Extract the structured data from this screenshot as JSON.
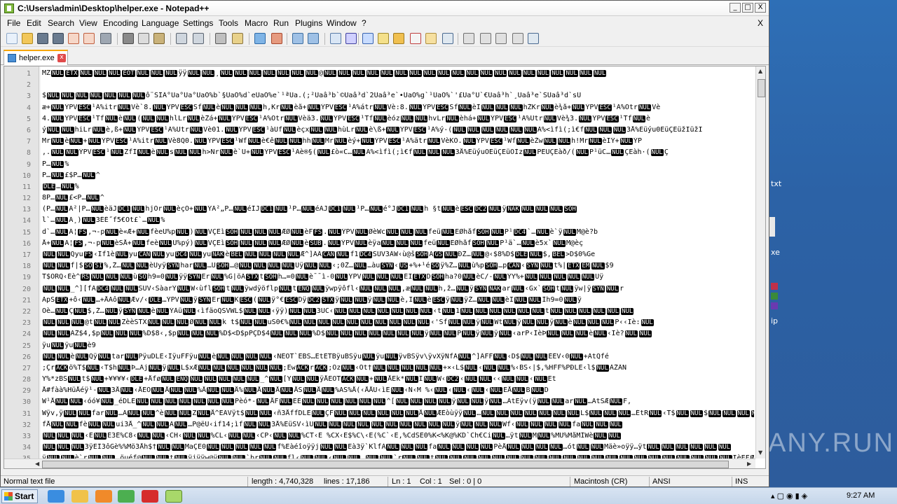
{
  "window": {
    "title": "C:\\Users\\admin\\Desktop\\helper.exe - Notepad++",
    "min": "_",
    "max": "□",
    "close": "X"
  },
  "menu": {
    "items": [
      "File",
      "Edit",
      "Search",
      "View",
      "Encoding",
      "Language",
      "Settings",
      "Tools",
      "Macro",
      "Run",
      "Plugins",
      "Window",
      "?"
    ],
    "close_doc": "X"
  },
  "toolbar": {
    "icons": [
      "new-file-icon",
      "open-file-icon",
      "save-icon",
      "save-all-icon",
      "close-icon",
      "close-all-icon",
      "print-icon",
      "cut-icon",
      "copy-icon",
      "paste-icon",
      "undo-icon",
      "redo-icon",
      "find-icon",
      "replace-icon",
      "zoom-in-icon",
      "zoom-out-icon",
      "sync-v-icon",
      "sync-h-icon",
      "word-wrap-icon",
      "all-chars-icon",
      "indent-guide-icon",
      "user-lang-icon",
      "doc-map-icon",
      "function-list-icon",
      "folder-workspace-icon",
      "monitor-icon",
      "record-macro-icon",
      "stop-record-icon",
      "play-macro-icon",
      "play-multiple-icon",
      "save-macro-icon"
    ]
  },
  "tab": {
    "label": "helper.exe",
    "close": "x"
  },
  "editor": {
    "lines": [
      {
        "n": "1",
        "text": "MZ\u0000\u0003\u0000\u0000\u0000\u0004\u0000\u0000\u0000ÿÿ\u0000\u0000¸\u0000\u0000\u0000\u0000\u0000\u0000\u0000@\u0000\u0000\u0000\u0000\u0000\u0000\u0000\u0000\u0000\u0000\u0000\u0000\u0000\u0000\u0000\u0000\u0000\u0000\u0000\u0000"
      },
      {
        "n": "2",
        "text": ""
      },
      {
        "n": "3",
        "text": "$\u0000\u0000\u0000\u0000\u0000\u0000\u0000ô¨SIÃ°Ûa°Ûa°ÛaÕ%b`§ŨaÕ%d`eŨaÕ%e`¹ªŨa.(;²Ûaâ³b`©Ûaâ³d`2Ûaâ³e`•ŨaÕ%g`¹ŨaÕ%`'£Ûa°Û`€Ûaâ³h`¸Ûaâ³e`ŠŨaâ³d`sŨ"
      },
      {
        "n": "4",
        "text": "æ+\u0000ÝPV\u001b¹Ã%itr\u0000Vè`8.\u0000ÝPV\u001bŠf\u0000è\u0000\u0000\u0000h,Kr\u0000èå+\u0000ÝPV\u001b¹Ã%átr\u0000Vè:8.\u0000ÝPV\u001bŠf\u0000èÌ\u0000\u0000\u0000hŽKr\u0000è¾å+\u0000ÝPV\u001b¹Ã%Ötr\u0000Vè"
      },
      {
        "n": "5",
        "text": "4.\u0000ÝPV\u001b¹Tf\u0000è\u0000(\u0000\u0000hlLr\u0000èŽá+\u0000ÝPV\u001b¹Ã%Ötr\u0000Vèä3.\u0000ÝPV\u001b¹Tf\u0000èóz\u0000\u0000hvLr\u0000èhá+\u0000ÝPV\u001b¹Ã%Ütr\u0000Vè¾3.\u0000ÝPV\u001b¹Tf\u0000è"
      },
      {
        "n": "6",
        "text": "ý\u0000\u0000hiLr\u0000è,ß+\u0000ÝPV\u001b¹Ã%Ütr\u0000Vè01.\u0000ÝPV\u001b¹àUf\u0000èçx\u0000\u0000hùLr\u0000è\\ß+\u0000ÝPV\u001b¹Ã%ý-(\u0000\u0000\u0000\u0000\u0000\u0000Ã%<ìfì(;ì€f\u0000\u0000\u00003Å%Eüýu0EüÇEüžIüžI"
      },
      {
        "n": "7",
        "text": "Mr\u0000è\u0000+\u0000ÝPV\u001b¹Ã%itr\u0000Vè8Q0.\u0000ÝPV\u001b¹Wf\u0000è€ê\u0000\u0000hh\u0000Mr\u0000èý+\u0000ÝPV\u001b¹Ã%ätr\u0000VèKO.\u0000ÝPV\u001b¹Wf\u0000èŽw\u0000\u0000h!Mr\u0000èÏÝ+\u0000ÝP"
      },
      {
        "n": "8",
        "text": ",.\u0000\u0000ÝPV\u001b¹\u0000ZfÌ\u0000è\u0000s\u0000\u0000h>Nr\u0000è`Ü+\u0000ÝPV\u001b¹Ãè®§(\u0000£ò«C…\u0000Ã%<ìfì(;ì€f\u0000\u0000\u00003Å%EüýuÔEüÇEüÕÌz\u0000PEÜÇEàð/(\u0000P¹üC…\u0000ÇEàh·(\u0000Ç"
      },
      {
        "n": "9",
        "text": "\fP…\u0000%"
      },
      {
        "n": "10",
        "text": " P…\u0000£$P…\u0000^"
      },
      {
        "n": "11",
        "text": "\u0010…\u0000%"
      },
      {
        "n": "12",
        "text": "8P…\u0000£<P…\u0000^"
      },
      {
        "n": "13",
        "text": "(P…\u0000Ã²|P…\u0000èäJ\u0011\u0000hjOr\u0000èçÔ+\u0000ÝÃ²„P…\u0000éÌJ\u0011\u0000¹P…\u0000éÄJ\u0011\u0000¹P…\u0000é°J\u0011\u0000h §t\u0000è\u001b\u0012\u0000ÿ\u0015\u0000\u0000\u0000\u0001"
      },
      {
        "n": "14",
        "text": "l`…\u0000Ã¸)\u00003ÉÉ˝f5€Ot£`…\u0000%"
      },
      {
        "n": "15",
        "text": "d`…\u0000Ã¦\u001c,¬-p\u0000è«Æ+\u0000fèeÜ%p\u0000)\u0000VÇEì\u0001\u0000\u0000\u0000ÆØ\u0000èF\u001c.\u0000ÝPV\u0000ØèWc\u0000\u0000\u0000feü\u0000EØhåf\u0001\u0000P¹\u0014`…\u0000è`ÿ\u0000M@è?b"
      },
      {
        "n": "16",
        "text": "Å+\u0000Ã¦\u001c,¬-p\u0000èSÅ+\u0000feè\u0000Ü%pý)\u0000VÇEì\u0001\u0000\u0000\u0000ÆØ\u0000è\u001a.\u0000ÝPV\u0000èÿa\u0000\u0000\u0000feü\u0000EØhåf\u0001\u0000P¹ä`…\u0000è5x`\u0000M@èç"
      },
      {
        "n": "17",
        "text": "\u0000\u0000Qyu\u001c‹Ìf1è\u0000yu\u0018\u0000yu\u0014\u0000yu\u0015è\u0007\u0000\u0000\u0000\u0000Æ^]ÃÂ\u0018\u0000f1\u0014SUV3ÀW‹ù@š\u0001Ã\u001d\u0000ÐŽ…\u0000@‹$8%D$\u0010\u0000$,\u0007>D$0%Ge"
      },
      {
        "n": "18",
        "text": "\u0000\u0000f|$\u000e\u000f%,Ž…\u0000\u0000èUyÿ\u0016har\u0000…Ü\u0001…@\u0000\u0000\u0000\u0000Uÿ\u0000\u0000‹;0Ž…\u0000…àu\u0016‹\u001f+%+¹é\u000eÿ%Ž…\u0000ù%p\u0001…p\u0018‹\u0016\u0000t%|\u0003\u0019\u0000$9"
      },
      {
        "n": "19",
        "text": "T$ORQ‹Èè^\u001e\u0000\u0000\u0000ù\u000eh9=0\u0000ÿÿ\u0016Er\u0000%G|öÃ\u0002t\u0001h…=0\u0000è¯¯ì-0\u0000ÝPV\u0000\u0000\u0000ÉÏ\u0003D\u0001ha?0\u0000èC/-\u0000ÝY%+\u0000\u0000\u0000\u0000\u0000Uÿ"
      },
      {
        "n": "20",
        "text": "\u0000\u0000_^][fÃ\u0014\u0000\u0000SUV‹SàarÝ\u0000W‹ùfl\u0001t\u0000ÿwdÿöflp\u0000t\u0005\u0000ÿwpÿôfl‹\u0000\u0000\u0000,æ\u0000\u0000h,ž…\u0000ÿ\u0016\u0015ar\u0000‹Gx`\u0001t\u0000ÿw|ÿ\u0016\u0000r"
      },
      {
        "n": "21",
        "text": "ÄpS\u0003+ô‹\u0000…+ÅÄô\u0000Æv/‹\u0010…ÝPV\u0000ÿ\u0016Er\u0000K\u001b(\u0000ÿ°€\u001bDÿ\u0012\u0002ÿ\u0000\u0000ÿ\u0000\u0000è,Ï\u0000è\u001bÿ\u0000ÿŽ…\u0000\u0000èÏ\u0000\u0000Ìh9=0\u0000ÿ"
      },
      {
        "n": "22",
        "text": "Ôè…\u0000Ç\u0000$,Ž…\u0000ÿ\u0016\u0000è\u0000ÝÀü\u0000‹ìfäoQSVWL$\u0000\u0000‹ÿÿ)\u0000\u00003ÛC‹\u0000\u0000\u0000\u0000\u0000\u0000\u0000‹t\u00001\u0000\u0000\u0000\u0000\u0000\u0000t\u0000\u0000\u0000\u0000\u0000\u0000"
      },
      {
        "n": "23",
        "text": "\u0000\u0000\u0000@t\u0000\u0000ZèèSTX\u0000\u0000\u0000Ø\u0000\u0000k t$\u0000\u0000uŠ0€%\u0000\u0000\u0000\u0000\u0000\u0000\u0000\u0000\u0000\u0000‹'Sf\u0000\u0000ÿ\u0000Wt\u0000ÿ\u0000\u0000ÿ\u0000è\u0000\u0000\u0000P‹‹Iè:\u0000"
      },
      {
        "n": "24",
        "text": "\u0000\u0000ÀŽ$4,$p\u0000\u0000\u0000%D$8‹,$p\u0000\u0000\u0000%D$<D$pPÇD$4\u0000\u0000\u0000%D$\u0000\u0000\u0000\u0000\u0000\u0000\u0000ÿ\u0000\u0000P\u0000ÿ\u0000ÿ\u0000‹arP‹ÌèÞ\u0000\u0000\u0000è\u0000‹Iè?\u0000\u0000"
      },
      {
        "n": "25",
        "text": "ÿu\u0000ÿu\u0000è9"
      },
      {
        "n": "26",
        "text": "\u0000\u0000è\u0000Qÿ\u0000tar\u0000PÿuDLE‹ÌÿuFFÿu\u0000è\u0000\u0000\u0000\u0000‹NEOT`EBS…ËtETBÿuBSÿu\u0000ÿu\u0000ÿvBSÿv\\ÿvXÿÑfÀ\u0000^]ÂFF\u0000‹D$\u0000\u0000ÉÉV‹0\u0000+ÀtQfé"
      },
      {
        "n": "27",
        "text": ";Çr\u0006ö%T$\u0000‹T$h\u0000Þ…Ãj\u0000ÿ\u0000L$xÆ\u0000\u0000\u0000\u0000\u0000\u0000;Ew\u0006r\u0006;Õz\u0000‹Õt†\u0000\u0000\u0000\u0000\u0000+×‹L$\u0000‹\u0000\u0000%‹BS‹|$,%HFF%PÐLE‹l$\u0000ÀŽÂN"
      },
      {
        "n": "28",
        "text": "Y%*zBS\u0000t$\u0000+¥¥¥¥‹\u0010+Åfø\u0000\u0005\u0000\u0000\u0000\u0000\u0000_^\u0000[Ÿ\u0000\u0000ÿÅEOT\u0006\u0000+\u0000ÅEk*\u0000Ì\u0000W‹\u0012‹\u0000\u0000‹‹\u0000\u0000‹\u0000Ët"
      },
      {
        "n": "29",
        "text": "Å#fàà%HüÅéÿ¹-\u00003Å\u0000‹ÅEO\u0000Å\u0000\u0000%Å\u0000\u0000Å%\u0000Å\u0000Å\u0000ÅS\u0000Å\u0000%AS%Å(‹ÅÅÜ‹ìE\u0000‹Ñ‹M %‹\u0000‹\u0000‹\u0000‹\u0000EÅ\u0000B\u0000D"
      },
      {
        "n": "30",
        "text": "W¹Å\u0000\u0000‹óó¥\u0000_éDLE\u0000\u0000\u0000\u0000\u0000\u0000\u0000Pèó*-\u0000ÅF\u0000EÈ\u0000\u0000\u0000\u0000\u0000\u0000^[\u0000\u0000\u0000\u0000ÿ\u0000\u0000ÿ\u0000…ÄtEÿv(ÿ\u0000\u0000ar\u0000…ÄtSÆ\u0000F,"
      },
      {
        "n": "31",
        "text": "Wÿv,ÿ\u0000\u0000far\u0000…Ã\u0000\u0000^è\u0000\u0000Z\u0000Å^EÃVÿt$\u0000\u0000‹ñ3ÅffDLE\u0000ÇF\u0000\u0000\u0000\u0000\u0000\u0000Å\u0000ÆÈòùÿÿ\u0000…\u0000\u0000\u0000\u0000\u0000\u0000\u0000L$\u0000\u0000\u0000…ÉtR\u0000‹T$\u0000\u0000$\u0000\u0000\u0000\u0000\u0000\u0000"
      },
      {
        "n": "32",
        "text": "fÅ\u0000\u0000fè\u0000\u0000ui3Å_^\u0000\u0000A\u0000…P@ëŪ‹if14;ìf\u0000\u00003Å%EüSV‹ìÚ\u0000\u0000\u0000\u0000\u0000\u0000\u0000\u0000\u0000\u0000ÿ\u0000\u0000\u0000Wf‹\u0000\u0000\u0000\u0000fa\u0000\u0000\u0000"
      },
      {
        "n": "33",
        "text": "\u0000\u0000\u0000‹E\u0000É3É%C8‹\u0000\u0000‹CH‹\u0000\u0000%CL‹\u0000\u0000‹CP‹\u0000\u0000%CT‹E %CX‹E$%C\\‹E(%C`‹E,%CdSE0%K<%K@%KD`Ch€Ci\u0000…ÿt\u0000M\u0000%MÜ%MåMÌWè\u0000\u0000"
      },
      {
        "n": "34",
        "text": "\u0000\u0000\u00003ÿEÌ3ôGè%%Mö3Åh$†\u0000\u0000MaÇE0\u0000\u0000\u0000\u0000\u0000f%Ëàéîoÿÿj\u0000\u0000Eà3ÿ`KlfÀ\u0000\u0000\u0000fa\u0000\u0000\u0000\u0000PèÅ\u0000\u0000\u0000\u0000…ót\u0000\u0000Mäè»oÿÿ…ÿt\u0000\u0000\u0000\u0000\u0000\u0000"
      },
      {
        "n": "35",
        "text": "ÿ\u0000\u0000è`r\u0000\u0000…öuéf@\u0000\u0000t\u0000ÿjÿÿw@ÿ\u0000\u0000`br\u0000\u0000fl‹\u0000\u0000‹\u0000\u0000…\u0000\u0000`r\u0000\u0000t\u0000\u0000\u0000\u0000\u0000\u0000\u0000\u0000\u0000\u0000\u0000\u0000\u0000\u0000\u0000\u0000\u0000\u0000\u0000\u0000\u0000ÏèEF\u0000\u0000\u0000\u0000\u0000\u0000\u0000\u0000\u0000\u0000\u0000\u0000\u0000\u0000ÏèSQ"
      }
    ]
  },
  "status": {
    "type": "Normal text file",
    "length": "length : 4,740,328",
    "lines": "lines : 17,186",
    "ln": "Ln : 1",
    "col": "Col : 1",
    "sel": "Sel : 0 | 0",
    "eol": "Macintosh (CR)",
    "encoding": "ANSI",
    "mode": "INS"
  },
  "taskbar": {
    "start": "Start",
    "time": "9:27 AM"
  },
  "desktop": {
    "label_txt": "txt",
    "label_xe": "xe",
    "label_ip": "ip"
  },
  "watermark": "ANY.RUN"
}
